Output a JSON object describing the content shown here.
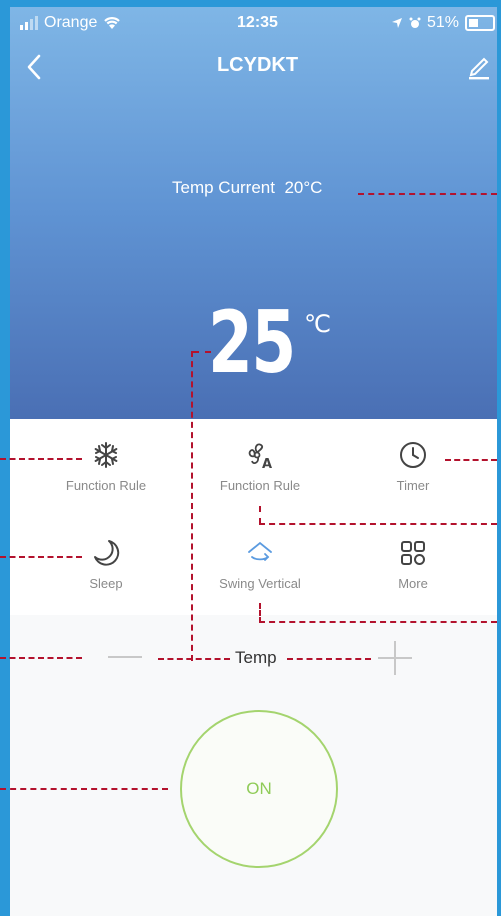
{
  "status": {
    "carrier": "Orange",
    "time": "12:35",
    "battery": "51%"
  },
  "nav": {
    "title": "LCYDKT"
  },
  "temp_current": {
    "label": "Temp Current",
    "value": "20°C"
  },
  "setpoint": {
    "value": "25",
    "unit": "℃"
  },
  "functions": [
    {
      "label": "Function Rule",
      "icon": "snowflake-icon"
    },
    {
      "label": "Function Rule",
      "icon": "fan-auto-icon"
    },
    {
      "label": "Timer",
      "icon": "clock-icon"
    },
    {
      "label": "Sleep",
      "icon": "moon-icon"
    },
    {
      "label": "Swing Vertical",
      "icon": "swing-icon"
    },
    {
      "label": "More",
      "icon": "grid-icon"
    }
  ],
  "temp_control": {
    "label": "Temp"
  },
  "power": {
    "label": "ON"
  },
  "colors": {
    "accent_green": "#8fcb58",
    "annotation_red": "#b3122d",
    "frame_blue": "#2b98d8"
  }
}
